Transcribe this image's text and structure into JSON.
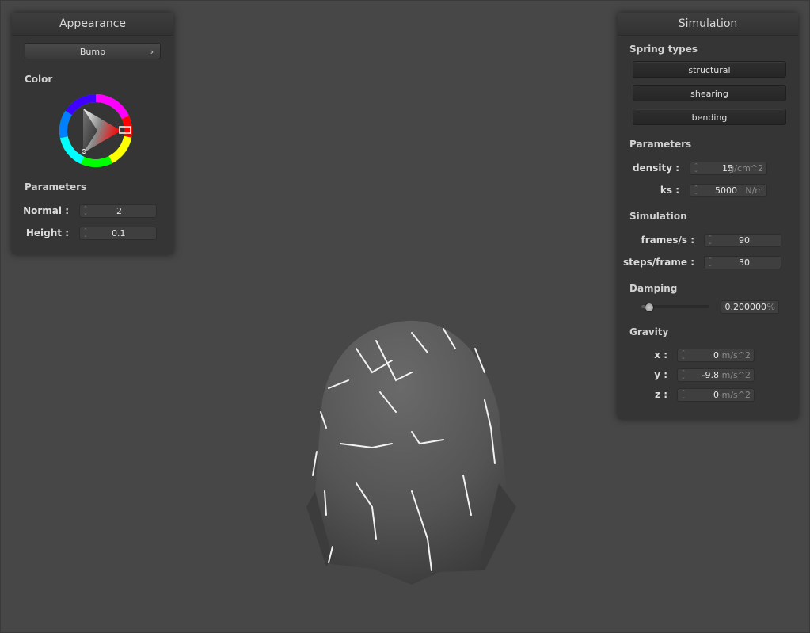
{
  "appearance": {
    "title": "Appearance",
    "shader_button": "Bump",
    "color_label": "Color",
    "parameters_label": "Parameters",
    "normal_label": "Normal :",
    "normal_value": "2",
    "height_label": "Height :",
    "height_value": "0.1",
    "selected_color": "#e02020"
  },
  "simulation": {
    "title": "Simulation",
    "spring_types_label": "Spring types",
    "spring_buttons": [
      "structural",
      "shearing",
      "bending"
    ],
    "parameters_label": "Parameters",
    "density_label": "density :",
    "density_value": "15",
    "density_unit": "g/cm^2",
    "ks_label": "ks :",
    "ks_value": "5000",
    "ks_unit": "N/m",
    "simulation_label": "Simulation",
    "fps_label": "frames/s :",
    "fps_value": "90",
    "steps_label": "steps/frame :",
    "steps_value": "30",
    "damping_label": "Damping",
    "damping_value": "0.200000",
    "damping_unit": "%",
    "damping_fraction": 0.2,
    "gravity_label": "Gravity",
    "gx_label": "x :",
    "gx_value": "0",
    "gy_label": "y :",
    "gy_value": "-9.8",
    "gz_label": "z :",
    "gz_value": "0",
    "gravity_unit": "m/s^2"
  },
  "icons": {
    "dropdown": "chevron-right-icon",
    "spinner": "spinner-icon",
    "color_wheel": "color-wheel"
  }
}
